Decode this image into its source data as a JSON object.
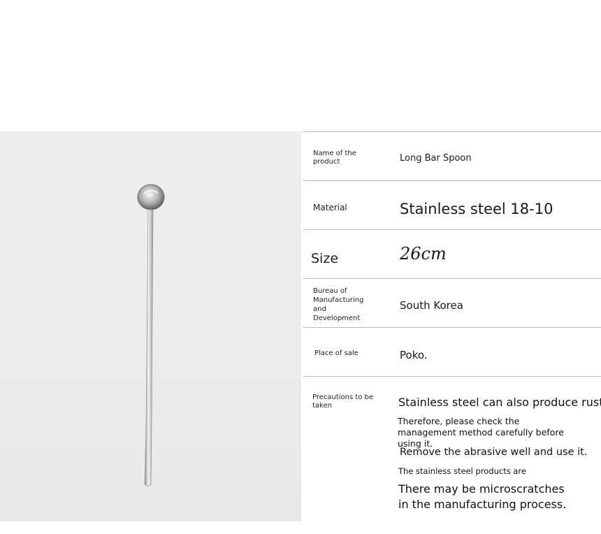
{
  "product_photo": {
    "subject": "spoon-illustration"
  },
  "spec": {
    "rows": [
      {
        "label": "Name of the product",
        "value": "Long Bar Spoon"
      },
      {
        "label": "Material",
        "value": "Stainless steel 18-10"
      },
      {
        "label": "Size",
        "value": "26cm"
      },
      {
        "label": "Bureau of Manufacturing and Development",
        "value": "South Korea"
      },
      {
        "label": "Place of sale",
        "value": "Poko."
      }
    ],
    "precautions": {
      "label": "Precautions to be taken",
      "lines": [
        "Stainless steel can also produce rust",
        "Therefore, please check the management method carefully before using it.",
        "Remove the abrasive well and use it.",
        "The stainless steel products are",
        "There may be microscratches in the manufacturing process."
      ]
    }
  }
}
